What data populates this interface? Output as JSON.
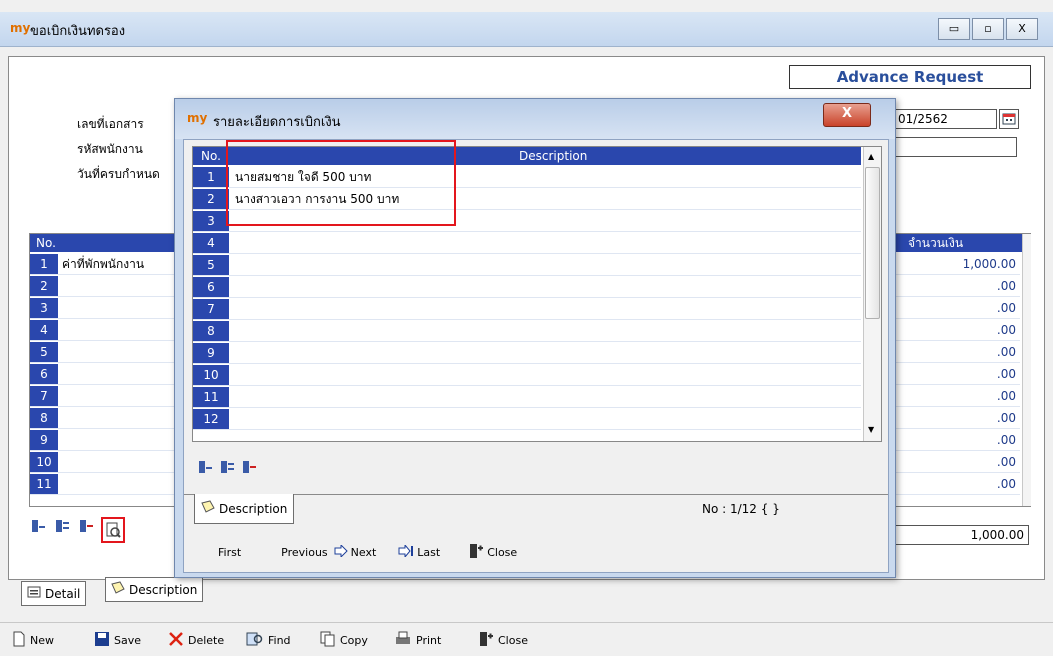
{
  "window": {
    "title": "ขอเบิกเงินทดรอง",
    "logo_text": "my",
    "minimize": "▭",
    "maximize": "▫",
    "close": "X"
  },
  "form": {
    "heading": "Advance Request",
    "doc_no_label": "เลขที่เอกสาร",
    "doc_no_value": "01/2562",
    "employee_label": "รหัสพนักงาน",
    "due_date_label": "วันที่ครบกำหนด"
  },
  "main_grid": {
    "col_no": "No.",
    "col_amount": "จำนวนเงิน",
    "rows": [
      {
        "no": "1",
        "desc": "ค่าที่พักพนักงาน",
        "amount": "1,000.00"
      },
      {
        "no": "2",
        "desc": "",
        "amount": ".00"
      },
      {
        "no": "3",
        "desc": "",
        "amount": ".00"
      },
      {
        "no": "4",
        "desc": "",
        "amount": ".00"
      },
      {
        "no": "5",
        "desc": "",
        "amount": ".00"
      },
      {
        "no": "6",
        "desc": "",
        "amount": ".00"
      },
      {
        "no": "7",
        "desc": "",
        "amount": ".00"
      },
      {
        "no": "8",
        "desc": "",
        "amount": ".00"
      },
      {
        "no": "9",
        "desc": "",
        "amount": ".00"
      },
      {
        "no": "10",
        "desc": "",
        "amount": ".00"
      },
      {
        "no": "11",
        "desc": "",
        "amount": ".00"
      }
    ],
    "total": "1,000.00"
  },
  "main_tabs": {
    "detail": "Detail",
    "description": "Description"
  },
  "toolbar": {
    "new": "New",
    "save": "Save",
    "delete": "Delete",
    "find": "Find",
    "copy": "Copy",
    "print": "Print",
    "close": "Close"
  },
  "dialog": {
    "logo_text": "my",
    "title": "รายละเอียดการเบิกเงิน",
    "close": "X",
    "col_no": "No.",
    "col_desc": "Description",
    "rows": [
      {
        "no": "1",
        "desc": "นายสมชาย ใจดี 500 บาท"
      },
      {
        "no": "2",
        "desc": "นางสาวเอวา การงาน 500 บาท"
      },
      {
        "no": "3",
        "desc": ""
      },
      {
        "no": "4",
        "desc": ""
      },
      {
        "no": "5",
        "desc": ""
      },
      {
        "no": "6",
        "desc": ""
      },
      {
        "no": "7",
        "desc": ""
      },
      {
        "no": "8",
        "desc": ""
      },
      {
        "no": "9",
        "desc": ""
      },
      {
        "no": "10",
        "desc": ""
      },
      {
        "no": "11",
        "desc": ""
      },
      {
        "no": "12",
        "desc": ""
      }
    ],
    "tab_description": "Description",
    "record_status": "No : 1/12 { }",
    "nav_first": "First",
    "nav_previous": "Previous",
    "nav_next": "Next",
    "nav_last": "Last",
    "nav_close": "Close"
  },
  "colors": {
    "grid_header": "#2a47ad",
    "highlight_box": "#e3161d",
    "amount_text": "#1e3a8a"
  }
}
